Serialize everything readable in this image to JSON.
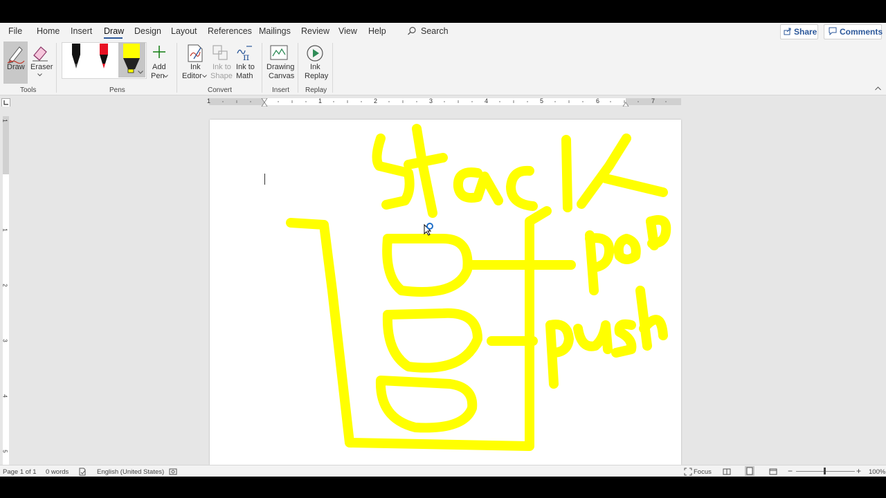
{
  "menu": {
    "items": [
      "File",
      "Home",
      "Insert",
      "Draw",
      "Design",
      "Layout",
      "References",
      "Mailings",
      "Review",
      "View",
      "Help"
    ],
    "active": "Draw",
    "search_label": "Search",
    "share_label": "Share",
    "comments_label": "Comments"
  },
  "ribbon": {
    "tools": {
      "draw_label": "Draw",
      "eraser_label": "Eraser",
      "group_label": "Tools"
    },
    "pens": {
      "colors": [
        "#000000",
        "#e81123",
        "#ffff00"
      ],
      "add_pen_line1": "Add",
      "add_pen_line2": "Pen",
      "group_label": "Pens"
    },
    "convert": {
      "ink_editor_line1": "Ink",
      "ink_editor_line2": "Editor",
      "ink_to_shape_line1": "Ink to",
      "ink_to_shape_line2": "Shape",
      "ink_to_math_line1": "Ink to",
      "ink_to_math_line2": "Math",
      "group_label": "Convert"
    },
    "insert": {
      "drawing_canvas_line1": "Drawing",
      "drawing_canvas_line2": "Canvas",
      "group_label": "Insert"
    },
    "replay": {
      "ink_replay_line1": "Ink",
      "ink_replay_line2": "Replay",
      "group_label": "Replay"
    }
  },
  "ruler": {
    "numbers": [
      "1",
      "1",
      "2",
      "3",
      "4",
      "5",
      "6",
      "7"
    ]
  },
  "vruler": {
    "numbers": [
      "1",
      "1",
      "2",
      "3",
      "4",
      "5"
    ]
  },
  "document": {
    "ink_color": "#ffff00"
  },
  "status": {
    "page": "Page 1 of 1",
    "words": "0 words",
    "language": "English (United States)",
    "focus": "Focus",
    "zoom": "100%"
  },
  "colors": {
    "accent": "#2b579a"
  }
}
